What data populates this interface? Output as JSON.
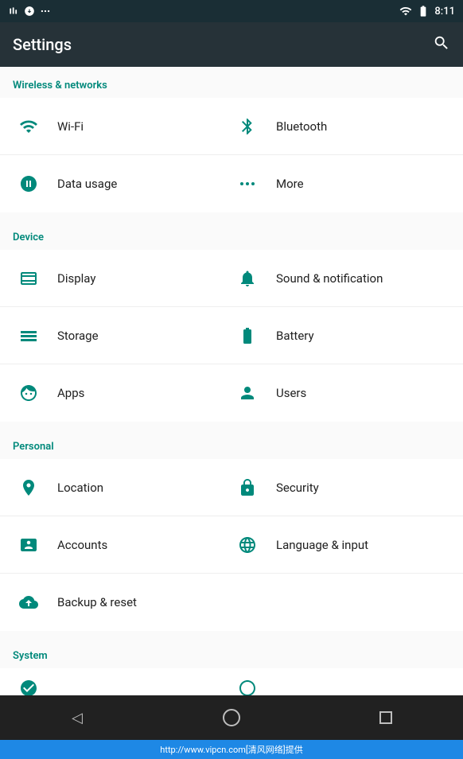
{
  "statusBar": {
    "time": "8:11",
    "icons": [
      "notification",
      "wifi",
      "battery"
    ]
  },
  "toolbar": {
    "title": "Settings",
    "searchLabel": "search"
  },
  "sections": [
    {
      "id": "wireless",
      "header": "Wireless & networks",
      "rows": [
        {
          "col1": {
            "icon": "wifi",
            "label": "Wi-Fi"
          },
          "col2": {
            "icon": "bluetooth",
            "label": "Bluetooth"
          }
        },
        {
          "col1": {
            "icon": "data-usage",
            "label": "Data usage"
          },
          "col2": {
            "icon": "more",
            "label": "More"
          }
        }
      ]
    },
    {
      "id": "device",
      "header": "Device",
      "rows": [
        {
          "col1": {
            "icon": "display",
            "label": "Display"
          },
          "col2": {
            "icon": "sound",
            "label": "Sound & notification"
          }
        },
        {
          "col1": {
            "icon": "storage",
            "label": "Storage"
          },
          "col2": {
            "icon": "battery",
            "label": "Battery"
          }
        },
        {
          "col1": {
            "icon": "apps",
            "label": "Apps"
          },
          "col2": {
            "icon": "users",
            "label": "Users"
          }
        }
      ]
    },
    {
      "id": "personal",
      "header": "Personal",
      "rows": [
        {
          "col1": {
            "icon": "location",
            "label": "Location"
          },
          "col2": {
            "icon": "security",
            "label": "Security"
          }
        },
        {
          "col1": {
            "icon": "accounts",
            "label": "Accounts"
          },
          "col2": {
            "icon": "language",
            "label": "Language & input"
          }
        },
        {
          "col1": {
            "icon": "backup",
            "label": "Backup & reset"
          },
          "col2": null
        }
      ]
    },
    {
      "id": "system",
      "header": "System",
      "rows": []
    }
  ],
  "bottomNav": {
    "back": "◁",
    "home": "○",
    "recent": "□"
  },
  "watermark": "http://www.vipcn.com[清风网络]提供"
}
